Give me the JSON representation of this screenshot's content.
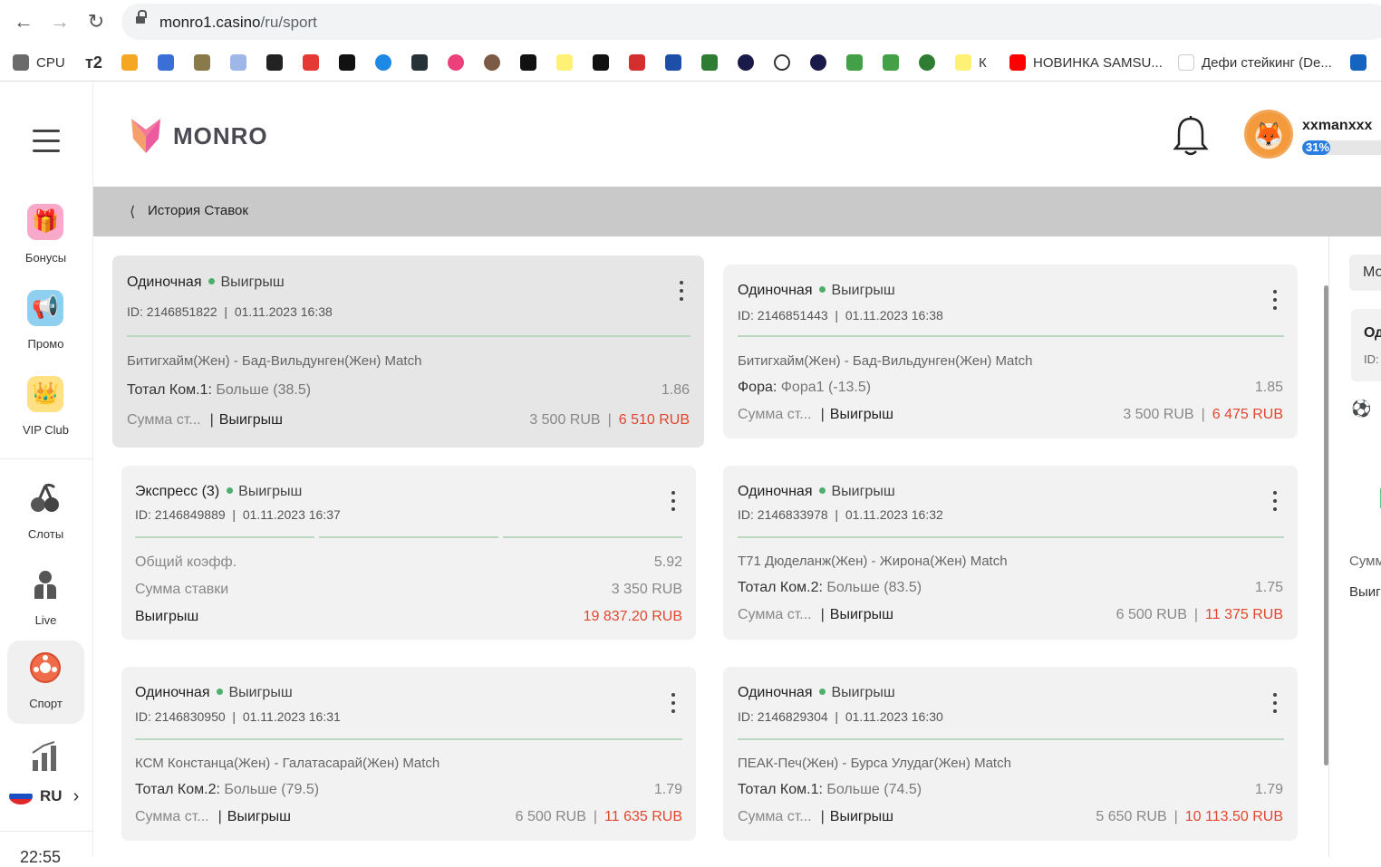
{
  "browser": {
    "url_host": "monro1.casino",
    "url_path": "/ru/sport",
    "bookmarks": [
      "CPU",
      "т2",
      "К",
      "НОВИНКА SAMSU...",
      "Дефи стейкинг (De..."
    ]
  },
  "sidebar": {
    "items": [
      {
        "label": "Бонусы",
        "icon": "gift-icon"
      },
      {
        "label": "Промо",
        "icon": "megaphone-icon"
      },
      {
        "label": "VIP Club",
        "icon": "crown-icon"
      },
      {
        "label": "Слоты",
        "icon": "cherries-icon"
      },
      {
        "label": "Live",
        "icon": "live-icon"
      },
      {
        "label": "Спорт",
        "icon": "soccer-ball-icon"
      }
    ],
    "language": "RU",
    "clock": "22:55"
  },
  "header": {
    "brand": "MONRO",
    "username": "xxmanxxx",
    "level_percent": "31%",
    "level_fraction": 0.31
  },
  "breadcrumb": {
    "title": "История Ставок"
  },
  "bets": [
    {
      "type": "Одиночная",
      "status": "Выигрыш",
      "id": "ID: 2146851822",
      "datetime": "01.11.2023 16:38",
      "match": "Битигхайм(Жен) - Бад-Вильдунген(Жен) Match",
      "market": "Тотал Ком.1:",
      "pick": "Больше (38.5)",
      "odds": "1.86",
      "sum_label": "Сумма ст...",
      "result": "Выигрыш",
      "stake": "3 500 RUB",
      "payout": "6 510 RUB"
    },
    {
      "type": "Одиночная",
      "status": "Выигрыш",
      "id": "ID: 2146851443",
      "datetime": "01.11.2023 16:38",
      "match": "Битигхайм(Жен) - Бад-Вильдунген(Жен) Match",
      "market": "Фора:",
      "pick": "Фора1 (-13.5)",
      "odds": "1.85",
      "sum_label": "Сумма ст...",
      "result": "Выигрыш",
      "stake": "3 500 RUB",
      "payout": "6 475 RUB"
    },
    {
      "type": "Экспресс (3)",
      "status": "Выигрыш",
      "id": "ID: 2146849889",
      "datetime": "01.11.2023 16:37",
      "total_odds_label": "Общий коэфф.",
      "total_odds": "5.92",
      "stake_label": "Сумма ставки",
      "stake": "3 350 RUB",
      "win_label": "Выигрыш",
      "payout": "19 837.20 RUB"
    },
    {
      "type": "Одиночная",
      "status": "Выигрыш",
      "id": "ID: 2146833978",
      "datetime": "01.11.2023 16:32",
      "match": "Т71 Дюделанж(Жен) - Жирона(Жен) Match",
      "market": "Тотал Ком.2:",
      "pick": "Больше (83.5)",
      "odds": "1.75",
      "sum_label": "Сумма ст...",
      "result": "Выигрыш",
      "stake": "6 500 RUB",
      "payout": "11 375 RUB"
    },
    {
      "type": "Одиночная",
      "status": "Выигрыш",
      "id": "ID: 2146830950",
      "datetime": "01.11.2023 16:31",
      "match": "КСМ Констанца(Жен) - Галатасарай(Жен) Match",
      "market": "Тотал Ком.2:",
      "pick": "Больше (79.5)",
      "odds": "1.79",
      "sum_label": "Сумма ст...",
      "result": "Выигрыш",
      "stake": "6 500 RUB",
      "payout": "11 635 RUB"
    },
    {
      "type": "Одиночная",
      "status": "Выигрыш",
      "id": "ID: 2146829304",
      "datetime": "01.11.2023 16:30",
      "match": "ПЕАК-Печ(Жен) - Бурса Улудаг(Жен) Match",
      "market": "Тотал Ком.1:",
      "pick": "Больше (74.5)",
      "odds": "1.79",
      "sum_label": "Сумма ст...",
      "result": "Выигрыш",
      "stake": "5 650 RUB",
      "payout": "10 113.50 RUB"
    }
  ],
  "right_panel": {
    "box_text": "Мо",
    "card_title": "Од",
    "card_id": "ID:",
    "label1": "Сумм",
    "label2": "Выиг"
  },
  "colors": {
    "win": "#e0472f",
    "status_dot": "#4caf6c",
    "level_bar": "#2a7de1"
  }
}
